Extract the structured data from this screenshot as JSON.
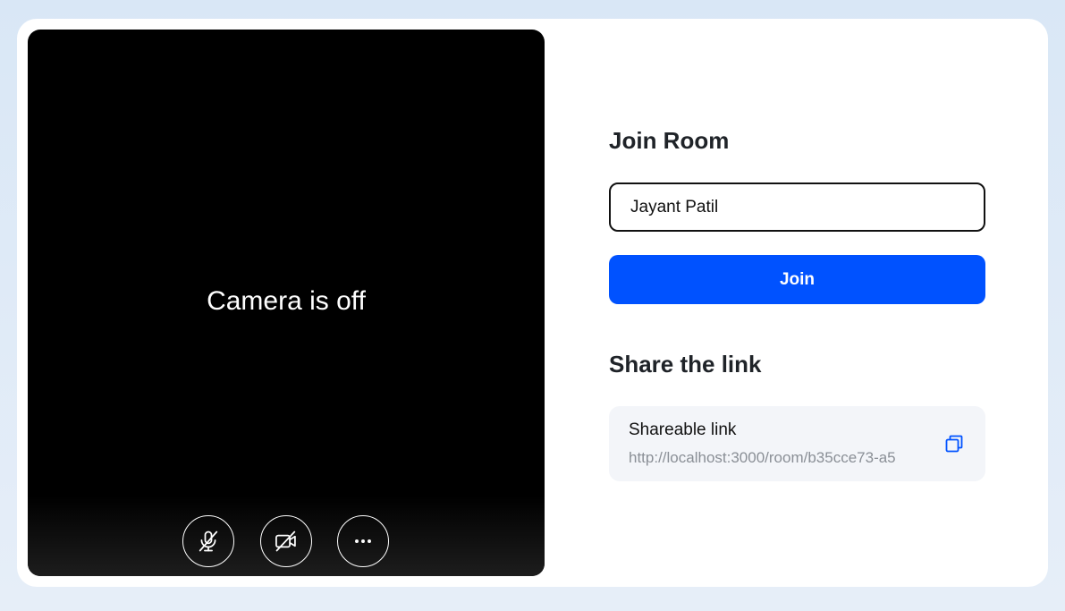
{
  "preview": {
    "status_text": "Camera is off",
    "controls": [
      {
        "name": "mic-toggle",
        "icon": "mic-off-icon"
      },
      {
        "name": "camera-toggle",
        "icon": "video-off-icon"
      },
      {
        "name": "more-options",
        "icon": "more-horizontal-icon"
      }
    ]
  },
  "join": {
    "title": "Join Room",
    "name_value": "Jayant Patil",
    "button_label": "Join"
  },
  "share": {
    "title": "Share the link",
    "link_label": "Shareable link",
    "link_url": "http://localhost:3000/room/b35cce73-a5",
    "copy_icon": "copy-icon"
  },
  "colors": {
    "accent": "#0052ff",
    "page_bg": "#d9e7f6",
    "preview_bg": "#000000",
    "link_box_bg": "#f3f5f9"
  }
}
